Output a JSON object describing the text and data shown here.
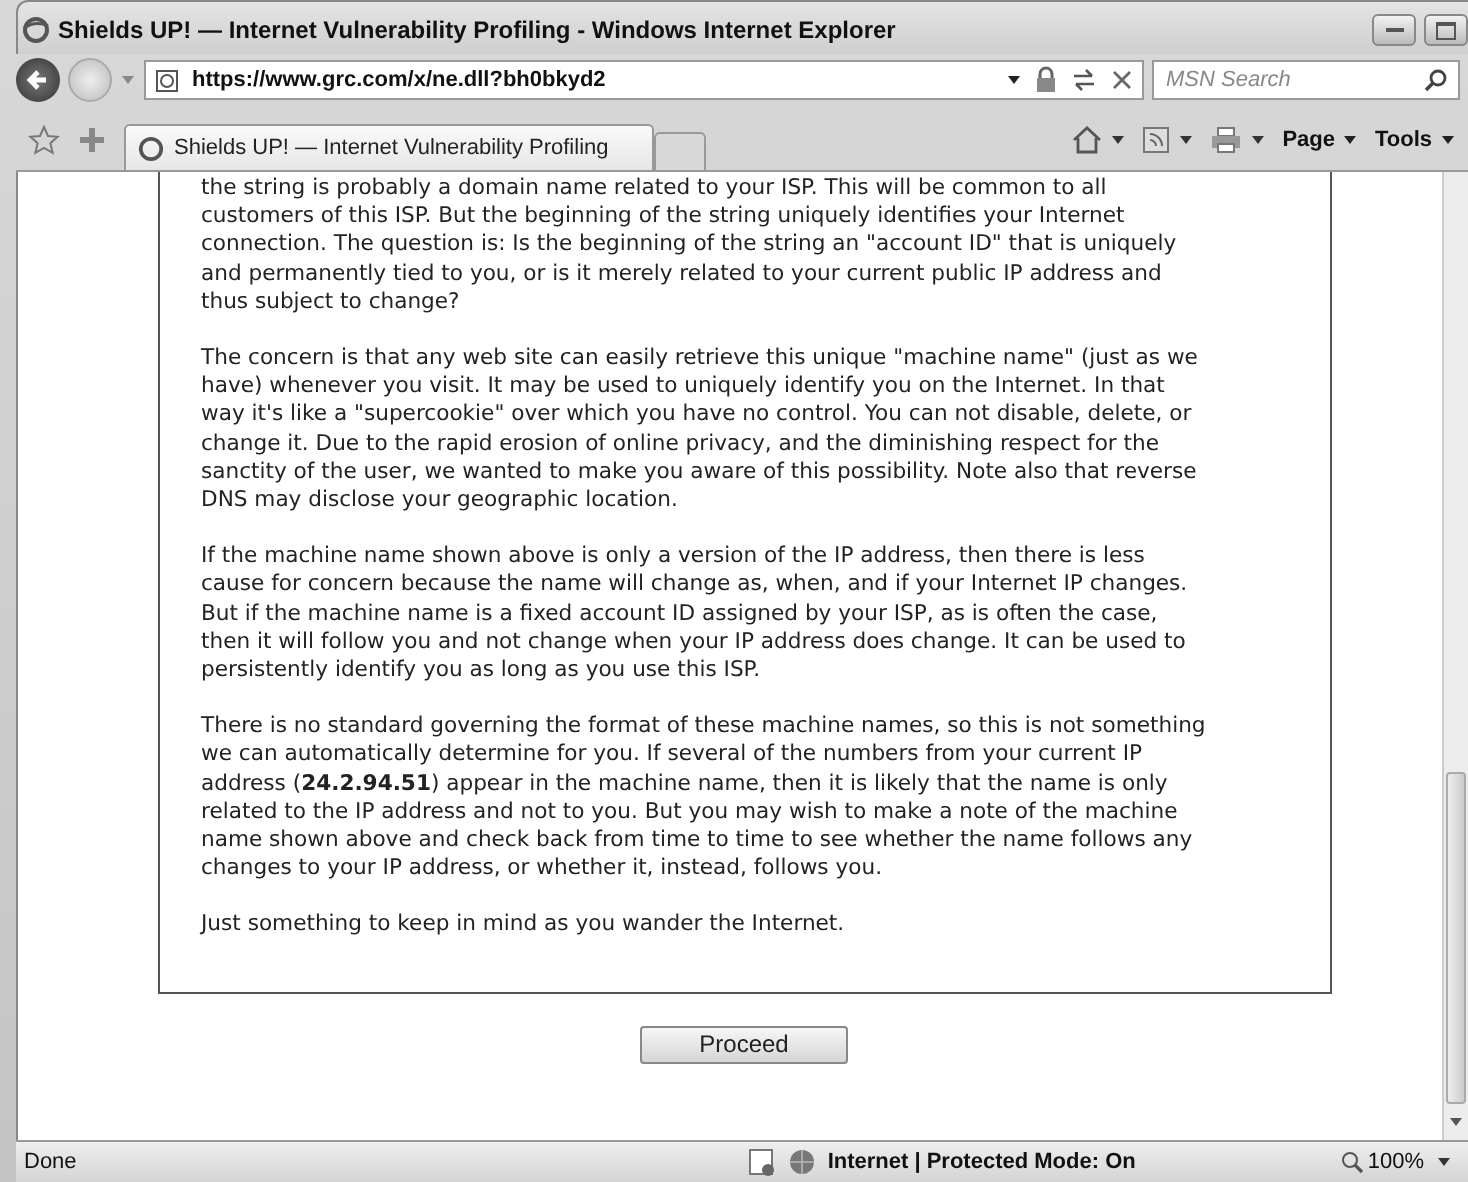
{
  "window": {
    "title": "Shields UP! — Internet Vulnerability Profiling - Windows Internet Explorer"
  },
  "address_bar": {
    "value": "https://www.grc.com/x/ne.dll?bh0bkyd2"
  },
  "search": {
    "placeholder": "MSN Search"
  },
  "tabs": [
    {
      "label": "Shields UP! — Internet Vulnerability Profiling",
      "selected": true
    }
  ],
  "toolbar": {
    "items": [
      {
        "kind": "icon"
      },
      {
        "kind": "icon"
      },
      {
        "kind": "icon"
      },
      {
        "kind": "menu",
        "label": "Page"
      },
      {
        "kind": "menu",
        "label": "Tools"
      }
    ]
  },
  "content": {
    "paragraphs": [
      "the string is probably a domain name related to your ISP. This will be common to all customers of this ISP. But the beginning of the string uniquely identifies your Internet connection. The question is: Is the beginning of the string an \"account ID\" that is uniquely and permanently tied to you, or is it merely related to your current public IP address and thus subject to change?",
      "The concern is that any web site can easily retrieve this unique \"machine name\" (just as we have) whenever you visit. It may be used to uniquely identify you on the Internet. In that way it's like a \"supercookie\" over which you have no control. You can not disable, delete, or change it. Due to the rapid erosion of online privacy, and the diminishing respect for the sanctity of the user, we wanted to make you aware of this possibility. Note also that reverse DNS may disclose your geographic location.",
      "If the machine name shown above is only a version of the IP address, then there is less cause for concern because the name will change as, when, and if your Internet IP changes. But if the machine name is a fixed account ID assigned by your ISP, as is often the case, then it will follow you and not change when your IP address does change. It can be used to persistently identify you as long as you use this ISP.",
      "There is no standard governing the format of these machine names, so this is not something we can automatically determine for you. If several of the numbers from your current IP address (**24.2.94.51**) appear in the machine name, then it is likely that the name is only related to the IP address and not to you. But you may wish to make a note of the machine name shown above and check back from time to time to see whether the name follows any changes to your IP address, or whether it, instead, follows you.",
      "Just something to keep in mind as you wander the Internet."
    ],
    "button": "Proceed"
  },
  "status_bar": {
    "left": "Done",
    "zone": "Internet | Protected Mode: On",
    "zoom": "100%"
  }
}
